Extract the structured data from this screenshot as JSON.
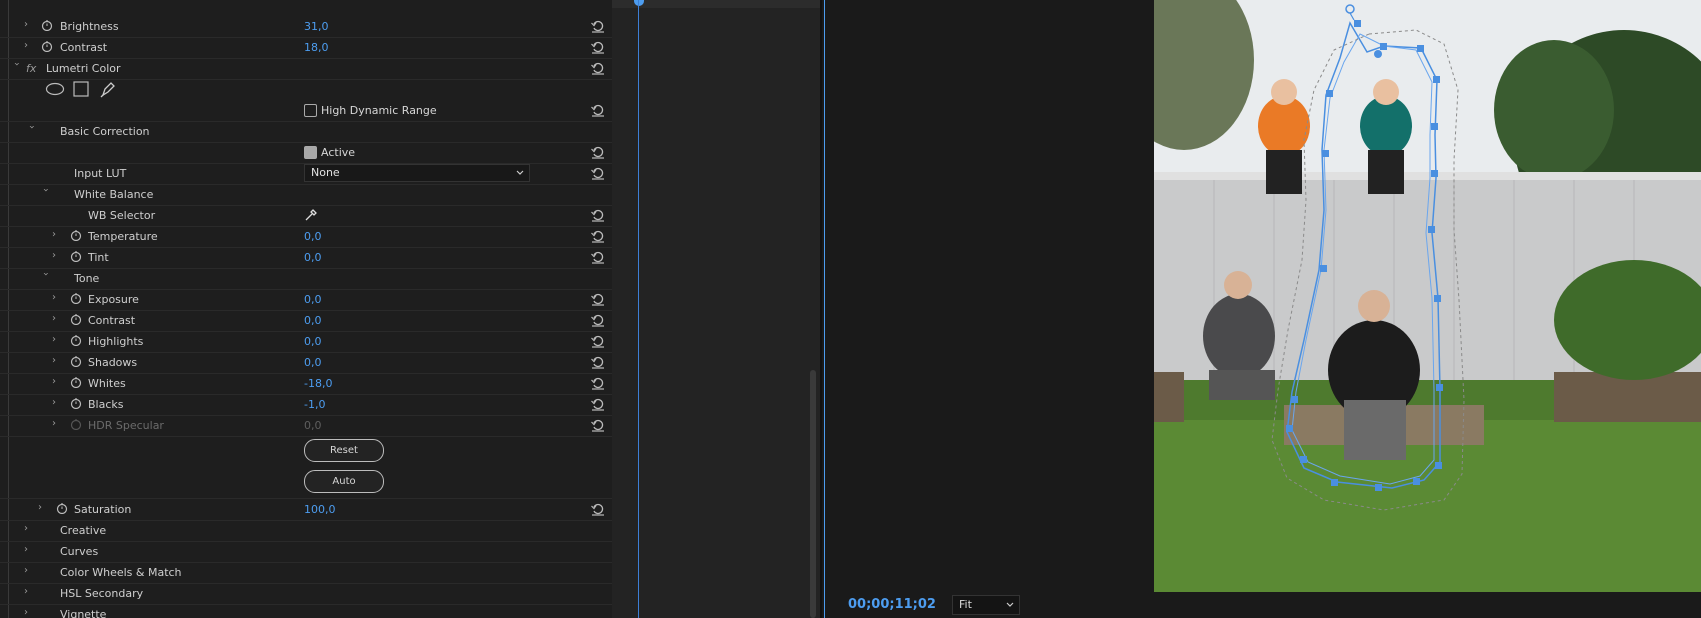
{
  "effects": {
    "brightness": {
      "label": "Brightness",
      "value": "31,0"
    },
    "contrast_top": {
      "label": "Contrast",
      "value": "18,0"
    },
    "lumetri_title": "Lumetri Color",
    "hdr_label": "High Dynamic Range",
    "basic_correction": "Basic Correction",
    "active_label": "Active",
    "input_lut": {
      "label": "Input LUT",
      "value": "None"
    },
    "white_balance": "White Balance",
    "wb_selector": "WB Selector",
    "temperature": {
      "label": "Temperature",
      "value": "0,0"
    },
    "tint": {
      "label": "Tint",
      "value": "0,0"
    },
    "tone": "Tone",
    "exposure": {
      "label": "Exposure",
      "value": "0,0"
    },
    "contrast": {
      "label": "Contrast",
      "value": "0,0"
    },
    "highlights": {
      "label": "Highlights",
      "value": "0,0"
    },
    "shadows": {
      "label": "Shadows",
      "value": "0,0"
    },
    "whites": {
      "label": "Whites",
      "value": "-18,0"
    },
    "blacks": {
      "label": "Blacks",
      "value": "-1,0"
    },
    "hdr_specular": {
      "label": "HDR Specular",
      "value": "0,0"
    },
    "reset_label": "Reset",
    "auto_label": "Auto",
    "saturation": {
      "label": "Saturation",
      "value": "100,0"
    },
    "sections": [
      "Creative",
      "Curves",
      "Color Wheels & Match",
      "HSL Secondary",
      "Vignette"
    ]
  },
  "monitor": {
    "timecode": "00;00;11;02",
    "fit": "Fit"
  },
  "colors": {
    "accent": "#4d9df0",
    "mask": "#4a8fe0"
  }
}
